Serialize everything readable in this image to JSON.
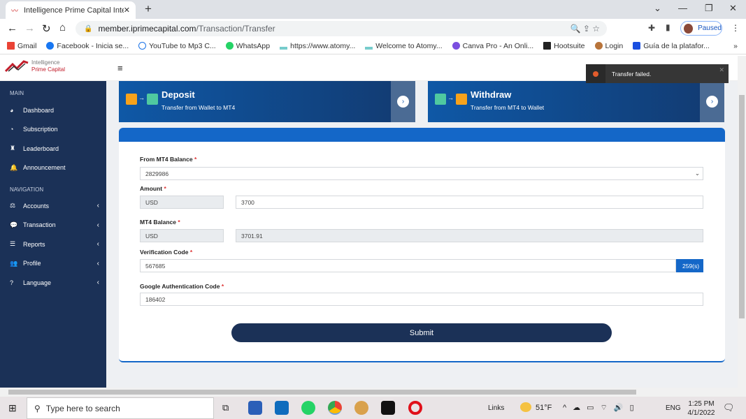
{
  "browser": {
    "tab_title": "Intelligence Prime Capital Interna",
    "url_domain": "member.iprimecapital.com",
    "url_path": "/Transaction/Transfer",
    "profile": "Paused",
    "bookmarks": [
      "Gmail",
      "Facebook - Inicia se...",
      "YouTube to Mp3 C...",
      "WhatsApp",
      "https://www.atomy...",
      "Welcome to Atomy...",
      "Canva Pro - An Onli...",
      "Hootsuite",
      "Login",
      "Guía de la platafor..."
    ]
  },
  "brand": {
    "line1": "Intelligence",
    "line2": "Prime Capital"
  },
  "sidebar": {
    "main_label": "MAIN",
    "nav_label": "NAVIGATION",
    "main_items": [
      {
        "label": "Dashboard",
        "icon": "◕"
      },
      {
        "label": "Subscription",
        "icon": "◔"
      },
      {
        "label": "Leaderboard",
        "icon": "♜"
      },
      {
        "label": "Announcement",
        "icon": "🔔"
      }
    ],
    "nav_items": [
      {
        "label": "Accounts",
        "icon": "⚖"
      },
      {
        "label": "Transaction",
        "icon": "💬"
      },
      {
        "label": "Reports",
        "icon": "☰"
      },
      {
        "label": "Profile",
        "icon": "👥"
      },
      {
        "label": "Language",
        "icon": "?"
      }
    ]
  },
  "cards": {
    "deposit": {
      "title": "Deposit",
      "subtitle": "Transfer from Wallet to MT4"
    },
    "withdraw": {
      "title": "Withdraw",
      "subtitle": "Transfer from MT4 to Wallet"
    }
  },
  "form": {
    "from_label": "From MT4 Balance",
    "from_value": "2829986",
    "amount_label": "Amount",
    "amount_currency": "USD",
    "amount_value": "3700",
    "balance_label": "MT4 Balance",
    "balance_currency": "USD",
    "balance_value": "3701.91",
    "verif_label": "Verification Code",
    "verif_value": "567685",
    "countdown": "259(s)",
    "google_label": "Google Authentication Code",
    "google_value": "186402",
    "required": "*",
    "submit": "Submit"
  },
  "toast": {
    "message": "Transfer failed."
  },
  "taskbar": {
    "search_placeholder": "Type here to search",
    "links": "Links",
    "weather": "51°F",
    "lang": "ENG",
    "time": "1:25 PM",
    "date": "4/1/2022"
  },
  "colors": {
    "sidebar": "#1b3157",
    "accent": "#1467c8",
    "submit": "#1b3157"
  }
}
